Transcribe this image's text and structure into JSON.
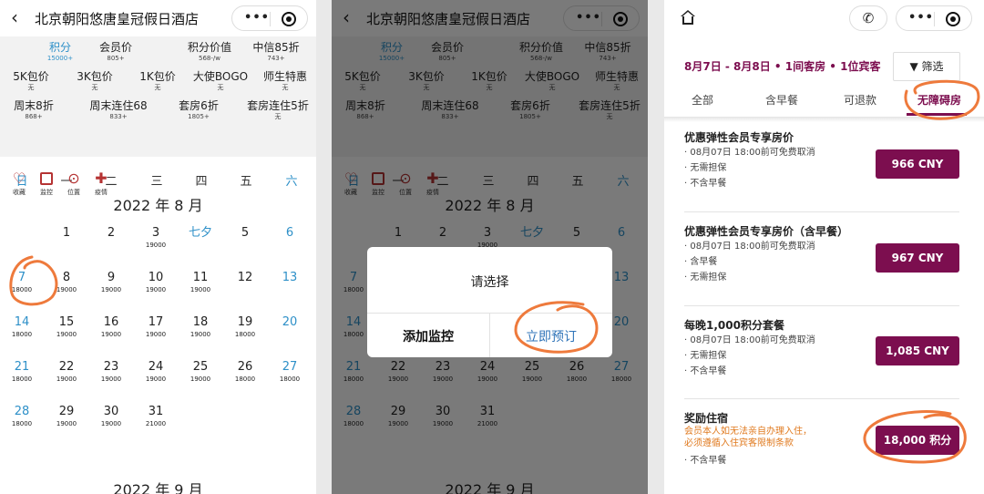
{
  "hotel": {
    "title": "北京朝阳悠唐皇冠假日酒店"
  },
  "discounts": [
    [
      {
        "name": "积分",
        "value": "15000+",
        "selected": true
      },
      {
        "name": "会员价",
        "value": "805+"
      },
      {
        "name": "积分价值",
        "value": "568-/w"
      },
      {
        "name": "中信85折",
        "value": "743+"
      }
    ],
    [
      {
        "name": "5K包价",
        "value": "无"
      },
      {
        "name": "3K包价",
        "value": "无"
      },
      {
        "name": "1K包价",
        "value": "无"
      },
      {
        "name": "大使BOGO",
        "value": "无"
      },
      {
        "name": "师生特惠",
        "value": "无"
      }
    ],
    [
      {
        "name": "周末8折",
        "value": "868+"
      },
      {
        "name": "周末连住68",
        "value": "833+"
      },
      {
        "name": "套房6折",
        "value": "1805+"
      },
      {
        "name": "套房连住5折",
        "value": "无"
      }
    ]
  ],
  "weekdays": [
    "日",
    "一",
    "二",
    "三",
    "四",
    "五",
    "六"
  ],
  "toolbar_icons": [
    {
      "name": "favorite-icon",
      "glyph": "♡",
      "label": "收藏"
    },
    {
      "name": "monitor-icon",
      "glyph": "box",
      "label": "监控"
    },
    {
      "name": "location-icon",
      "glyph": "⊙",
      "label": "位置"
    },
    {
      "name": "health-icon",
      "glyph": "✚",
      "label": "疫情"
    }
  ],
  "calendar": {
    "month_aug": "2022 年 8 月",
    "month_sep": "2022 年 9 月",
    "weeks": [
      [
        null,
        {
          "d": "1"
        },
        {
          "d": "2"
        },
        {
          "d": "3",
          "p": "19000"
        },
        {
          "d": "七夕",
          "blue": true
        },
        {
          "d": "5"
        },
        {
          "d": "6",
          "blue": true
        }
      ],
      [
        {
          "d": "7",
          "p": "18000",
          "blue": true
        },
        {
          "d": "8",
          "p": "19000"
        },
        {
          "d": "9",
          "p": "19000"
        },
        {
          "d": "10",
          "p": "19000"
        },
        {
          "d": "11",
          "p": "19000"
        },
        {
          "d": "12"
        },
        {
          "d": "13",
          "blue": true
        }
      ],
      [
        {
          "d": "14",
          "p": "18000",
          "blue": true
        },
        {
          "d": "15",
          "p": "19000"
        },
        {
          "d": "16",
          "p": "19000"
        },
        {
          "d": "17",
          "p": "19000"
        },
        {
          "d": "18",
          "p": "19000"
        },
        {
          "d": "19",
          "p": "18000"
        },
        {
          "d": "20",
          "blue": true
        }
      ],
      [
        {
          "d": "21",
          "p": "18000",
          "blue": true
        },
        {
          "d": "22",
          "p": "19000"
        },
        {
          "d": "23",
          "p": "19000"
        },
        {
          "d": "24",
          "p": "19000"
        },
        {
          "d": "25",
          "p": "19000"
        },
        {
          "d": "26",
          "p": "18000"
        },
        {
          "d": "27",
          "p": "18000",
          "blue": true
        }
      ],
      [
        {
          "d": "28",
          "p": "18000",
          "blue": true
        },
        {
          "d": "29",
          "p": "19000"
        },
        {
          "d": "30",
          "p": "19000"
        },
        {
          "d": "31",
          "p": "21000"
        },
        null,
        null,
        null
      ]
    ]
  },
  "dialog": {
    "title": "请选择",
    "left_button": "添加监控",
    "right_button": "立即预订"
  },
  "booking": {
    "dates": "8月7日 - 8月8日 • 1间客房 • 1位宾客",
    "filter": "筛选",
    "tabs": [
      "全部",
      "含早餐",
      "可退款",
      "无障碍房"
    ],
    "rates": [
      {
        "title": "优惠弹性会员专享房价",
        "lines": [
          "08月07日 18:00前可免费取消",
          "无需担保",
          "不含早餐"
        ],
        "price": "966 CNY"
      },
      {
        "title": "优惠弹性会员专享房价（含早餐）",
        "lines": [
          "08月07日 18:00前可免费取消",
          "含早餐",
          "无需担保"
        ],
        "price": "967 CNY"
      },
      {
        "title": "每晚1,000积分套餐",
        "lines": [
          "08月07日 18:00前可免费取消",
          "无需担保",
          "不含早餐"
        ],
        "price": "1,085 CNY"
      },
      {
        "title": "奖励住宿",
        "warn1": "会员本人如无法亲自办理入住，",
        "warn2": "必须遵循入住宾客限制条款",
        "lines": [
          "不含早餐"
        ],
        "price": "18,000 积分"
      }
    ]
  },
  "colors": {
    "accent": "#7c0e4f",
    "blue": "#2e90c8",
    "annotation": "#ee7a3c"
  }
}
